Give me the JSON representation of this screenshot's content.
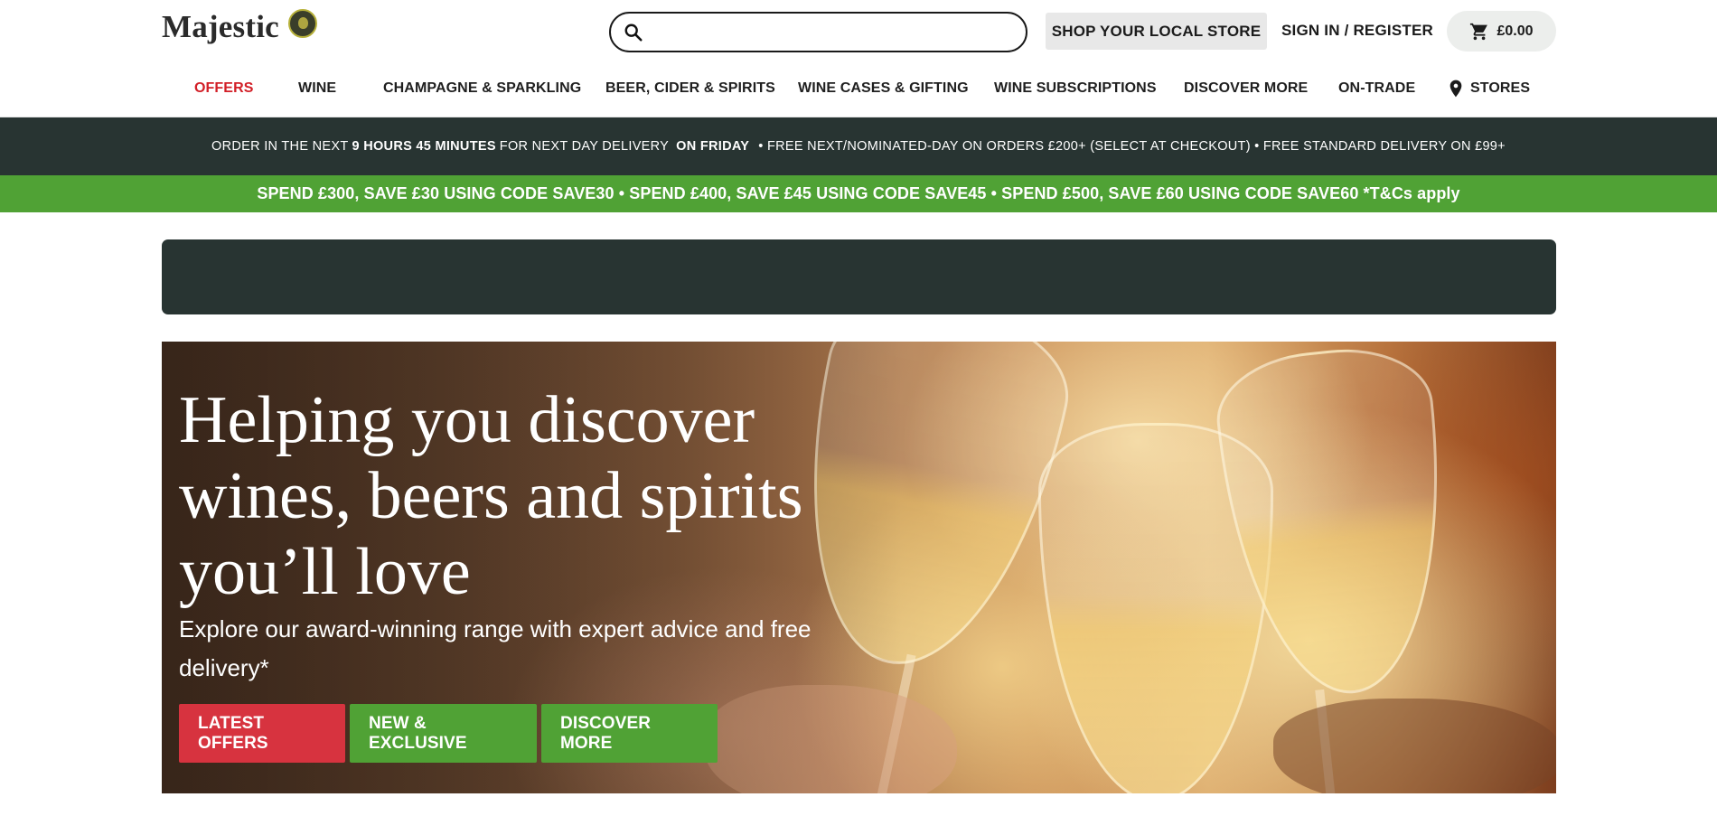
{
  "header": {
    "logo_text": "Majestic",
    "search": {
      "placeholder": "",
      "value": ""
    },
    "store_button": "SHOP YOUR LOCAL STORE",
    "signin_link": "SIGN IN / REGISTER",
    "cart_total": "£0.00"
  },
  "nav": {
    "items": [
      {
        "label": "OFFERS",
        "color": "#d21f27"
      },
      {
        "label": "WINE"
      },
      {
        "label": "CHAMPAGNE & SPARKLING"
      },
      {
        "label": "BEER, CIDER & SPIRITS"
      },
      {
        "label": "WINE CASES & GIFTING"
      },
      {
        "label": "WINE SUBSCRIPTIONS"
      },
      {
        "label": "DISCOVER MORE"
      },
      {
        "label": "ON-TRADE"
      },
      {
        "label": "STORES",
        "icon": "location-pin-icon"
      }
    ]
  },
  "delivery_bar": {
    "prefix": "ORDER IN THE NEXT",
    "countdown": "9 HOURS 45 MINUTES",
    "middle": "FOR NEXT DAY DELIVERY",
    "day": "ON FRIDAY",
    "suffix": "• FREE NEXT/NOMINATED-DAY ON ORDERS £200+ (SELECT AT CHECKOUT) • FREE STANDARD DELIVERY ON £99+"
  },
  "promo_bar": {
    "text": "SPEND £300, SAVE £30 USING CODE SAVE30 • SPEND £400, SAVE £45 USING CODE SAVE45 • SPEND £500, SAVE £60 USING CODE SAVE60 *T&Cs apply"
  },
  "hero": {
    "title": "Helping you discover wines, beers and spirits you’ll love",
    "subtitle": "Explore our award-winning range with expert advice and free delivery*",
    "buttons": {
      "latest_offers": "LATEST OFFERS",
      "new_exclusive": "NEW & EXCLUSIVE",
      "discover_more": "DISCOVER MORE"
    }
  },
  "colors": {
    "accent_red": "#d7333f",
    "accent_green": "#50a235",
    "dark_bar": "#283432"
  }
}
